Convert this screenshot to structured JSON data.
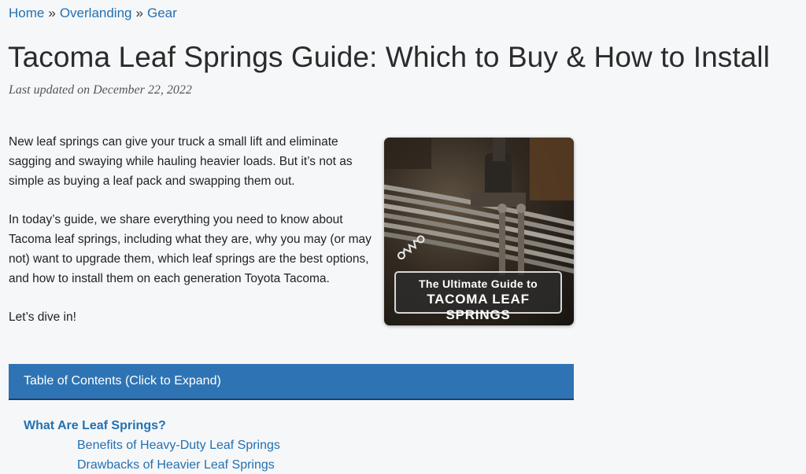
{
  "breadcrumb": {
    "items": [
      "Home",
      "Overlanding",
      "Gear"
    ],
    "separator": "»"
  },
  "article": {
    "title": "Tacoma Leaf Springs Guide: Which to Buy & How to Install",
    "updated": "Last updated on December 22, 2022",
    "paragraphs": [
      "New leaf springs can give your truck a small lift and eliminate sagging and swaying while hauling heavier loads. But it’s not as simple as buying a leaf pack and swapping them out.",
      "In today’s guide, we share everything you need to know about Tacoma leaf springs, including what they are, why you may (or may not) want to upgrade them, which leaf springs are the best options, and how to install them on each generation Toyota Tacoma.",
      "Let’s dive in!"
    ]
  },
  "feature_image": {
    "caption_line1": "The Ultimate Guide to",
    "caption_line2": "TACOMA LEAF SPRINGS"
  },
  "toc": {
    "header": "Table of Contents (Click to Expand)",
    "items": [
      {
        "label": "What Are Leaf Springs?",
        "level": 1
      },
      {
        "label": "Benefits of Heavy-Duty Leaf Springs",
        "level": 2
      },
      {
        "label": "Drawbacks of Heavier Leaf Springs",
        "level": 2
      }
    ]
  },
  "colors": {
    "link": "#2271b1",
    "toc_header_bg": "#2e74b5",
    "page_bg": "#f6f7f9"
  }
}
